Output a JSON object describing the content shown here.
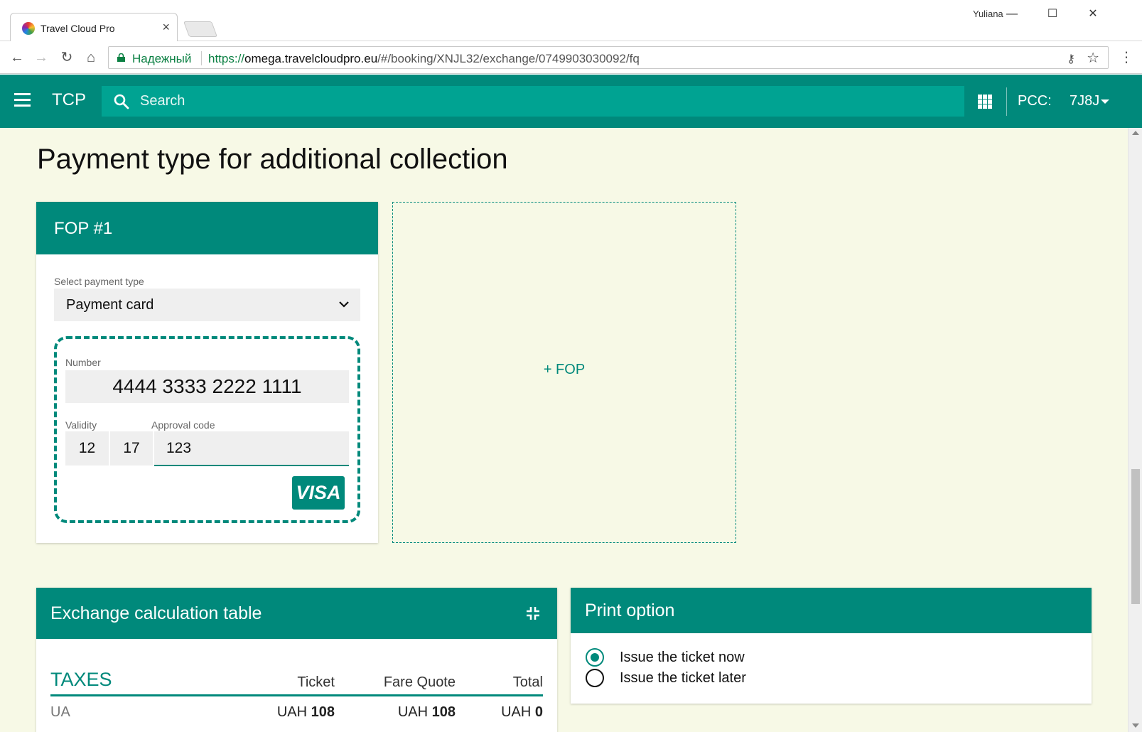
{
  "browser": {
    "tab_title": "Travel Cloud Pro",
    "tab_close": "×",
    "profile_name": "Yuliana",
    "window_minimize": "—",
    "window_maximize": "☐",
    "window_close": "✕",
    "back": "←",
    "forward": "→",
    "reload": "↻",
    "home": "⌂",
    "secure_label": "Надежный",
    "url_scheme": "https://",
    "url_host": "omega.travelcloudpro.eu",
    "url_path": "/#/booking/XNJL32/exchange/0749903030092/fq",
    "key": "⚷",
    "star": "☆",
    "menu": "⋮"
  },
  "appbar": {
    "brand": "TCP",
    "search_placeholder": "Search",
    "pcc_label": "PCC:",
    "pcc_value": "7J8J"
  },
  "page": {
    "title": "Payment type for additional collection"
  },
  "fop": {
    "header": "FOP #1",
    "select_label": "Select payment type",
    "select_value": "Payment card",
    "number_label": "Number",
    "number_value": "4444 3333 2222 1111",
    "validity_label": "Validity",
    "validity_month": "12",
    "validity_year": "17",
    "approval_label": "Approval code",
    "approval_value": "123",
    "card_brand": "VISA",
    "add_label": "+ FOP"
  },
  "exchange": {
    "header": "Exchange calculation table",
    "section": "TAXES",
    "columns": [
      "Ticket",
      "Fare Quote",
      "Total"
    ],
    "rows": [
      {
        "label": "UA",
        "ticket_cur": "UAH",
        "ticket": "108",
        "fq_cur": "UAH",
        "fq": "108",
        "total_cur": "UAH",
        "total": "0"
      }
    ]
  },
  "print": {
    "header": "Print option",
    "options": [
      {
        "label": "Issue the ticket now",
        "selected": true
      },
      {
        "label": "Issue the ticket later",
        "selected": false
      }
    ]
  },
  "colors": {
    "primary": "#00897b",
    "search_bg": "#00a392",
    "page_bg": "#f7f9e6",
    "secure_green": "#0b8043"
  },
  "icons": [
    "favicon-icon",
    "close-icon",
    "back-icon",
    "forward-icon",
    "reload-icon",
    "home-icon",
    "lock-icon",
    "key-icon",
    "star-icon",
    "menu-icon",
    "hamburger-icon",
    "search-icon",
    "apps-grid-icon",
    "caret-down-icon",
    "chevron-down-icon",
    "collapse-icon",
    "visa-logo",
    "radio-icon"
  ]
}
